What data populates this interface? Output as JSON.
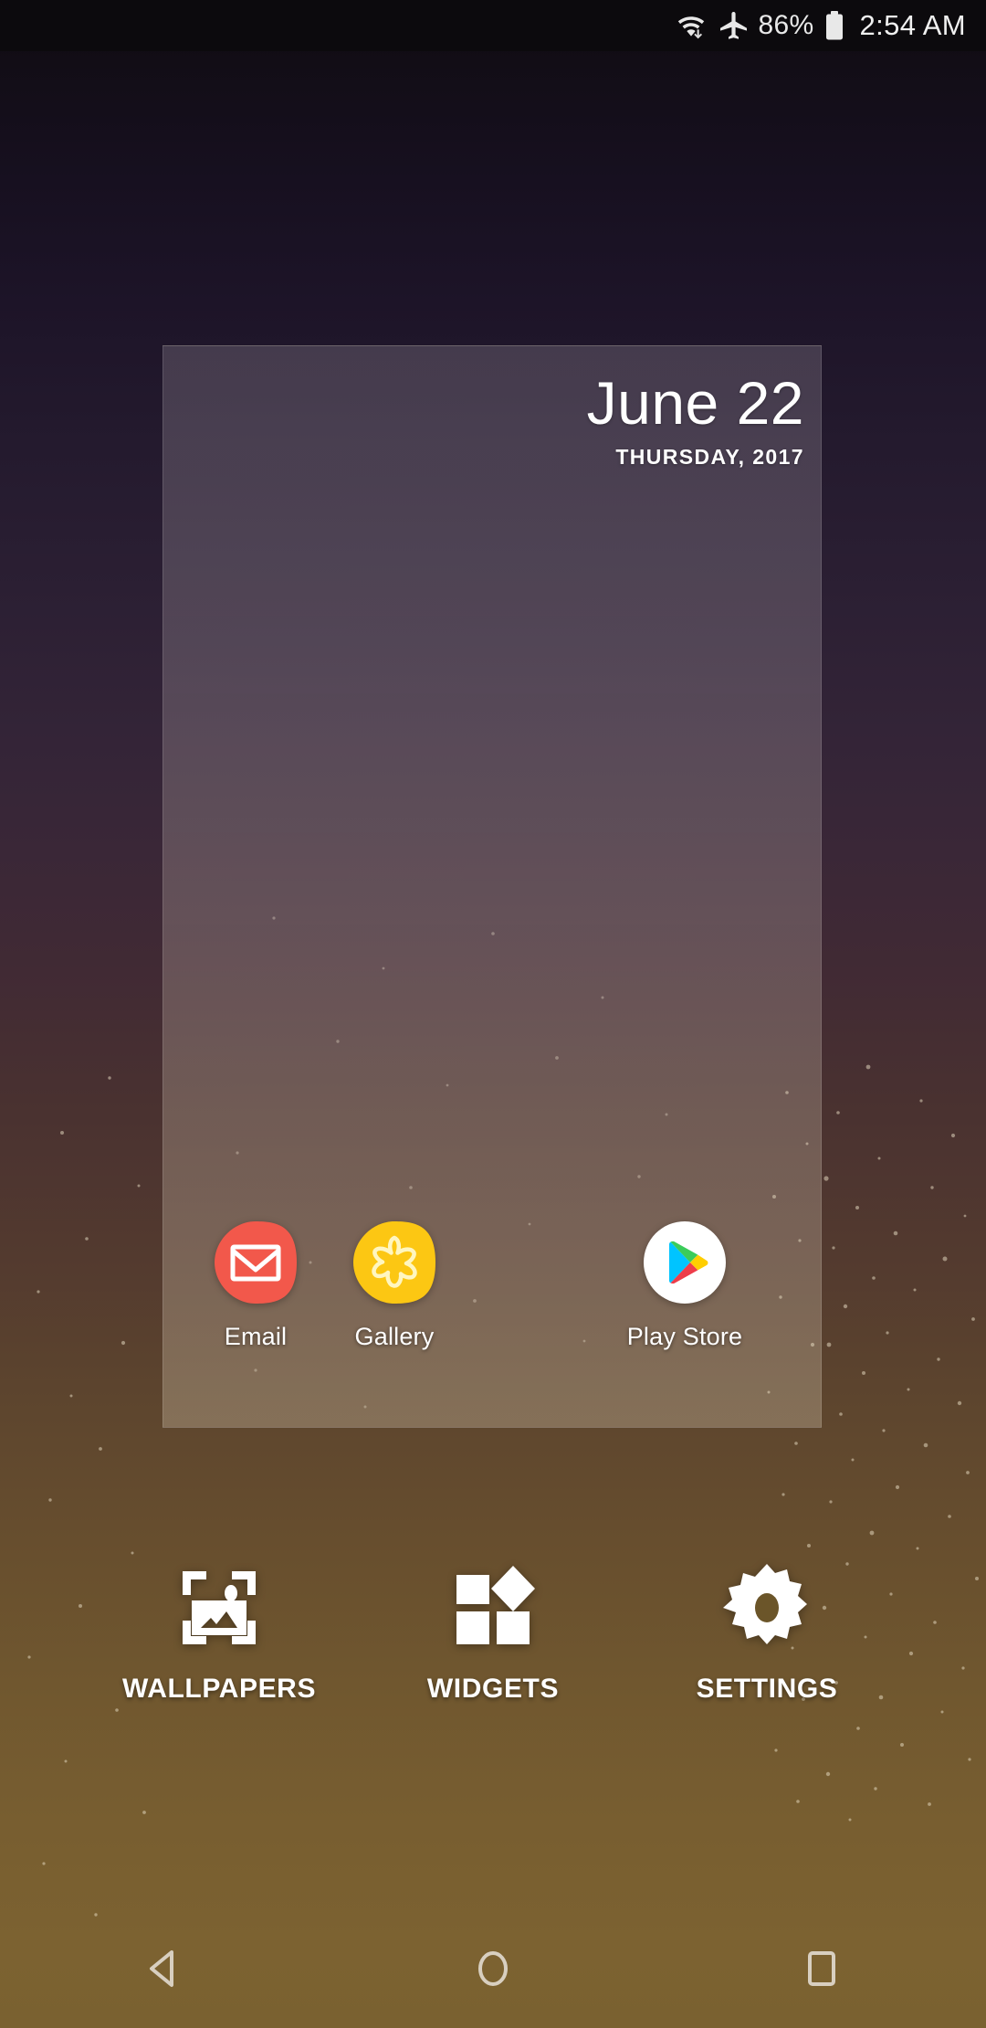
{
  "status_bar": {
    "wifi_icon": "wifi-with-data-arrows-icon",
    "airplane_icon": "airplane-mode-icon",
    "battery_percent": "86%",
    "battery_icon": "battery-full-icon",
    "clock": "2:54 AM",
    "background_color": "#0c0a0d",
    "text_color": "#e8e8e8"
  },
  "wallpaper": {
    "top_color": "#0d0a0f",
    "mid_color": "#412a34",
    "bottom_color": "#7a6130",
    "description": "dark purple to golden brown gradient with light dust speckles"
  },
  "widget": {
    "name": "clock-date-widget",
    "date_main": "June 22",
    "date_sub": "THURSDAY, 2017",
    "panel_overlay_color": "rgba(220,208,210,0.22)"
  },
  "apps": [
    {
      "id": "email",
      "label": "Email",
      "icon": "email-envelope-icon",
      "bg_color": "#f2584b",
      "fg_color": "#ffffff"
    },
    {
      "id": "gallery",
      "label": "Gallery",
      "icon": "gallery-flower-icon",
      "bg_color": "#fcc713",
      "fg_color": "#fff8c8"
    },
    {
      "id": "playstore",
      "label": "Play Store",
      "icon": "play-store-icon",
      "bg_color": "#ffffff",
      "fg_color": "#00a0ff"
    }
  ],
  "home_actions": [
    {
      "id": "wallpapers",
      "label": "WALLPAPERS",
      "icon": "wallpaper-picture-icon"
    },
    {
      "id": "widgets",
      "label": "WIDGETS",
      "icon": "widgets-blocks-icon"
    },
    {
      "id": "settings",
      "label": "SETTINGS",
      "icon": "settings-gear-icon"
    }
  ],
  "nav_bar": [
    {
      "id": "back",
      "label": "Back",
      "icon": "back-triangle-icon"
    },
    {
      "id": "home",
      "label": "Home",
      "icon": "home-circle-icon"
    },
    {
      "id": "recents",
      "label": "Recents",
      "icon": "recents-square-icon"
    }
  ],
  "play_store_colors": {
    "blue": "#00a0ff",
    "green": "#3bcc5a",
    "yellow": "#ffce00",
    "red": "#ee3d4a"
  },
  "nav_icon_color": "#d8cfc0"
}
